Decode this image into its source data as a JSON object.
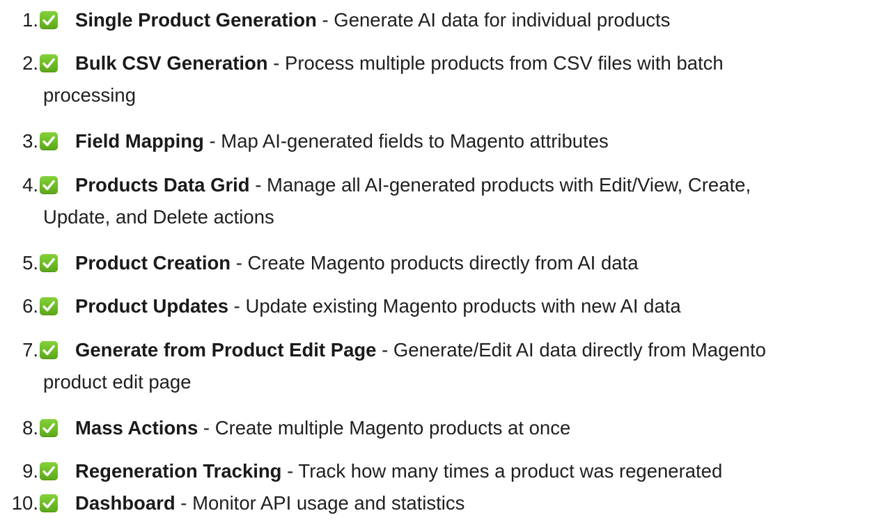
{
  "features": [
    {
      "num": "1.",
      "title": "Single Product Generation",
      "desc": " - Generate AI data for individual products",
      "cont": ""
    },
    {
      "num": "2.",
      "title": "Bulk CSV Generation",
      "desc": " - Process multiple products from CSV files with batch",
      "cont": "processing"
    },
    {
      "num": "3.",
      "title": "Field Mapping",
      "desc": " - Map AI-generated fields to Magento attributes",
      "cont": ""
    },
    {
      "num": "4.",
      "title": "Products Data Grid",
      "desc": " - Manage all AI-generated products with Edit/View, Create,",
      "cont": "Update, and Delete actions"
    },
    {
      "num": "5.",
      "title": "Product Creation",
      "desc": " - Create Magento products directly from AI data",
      "cont": ""
    },
    {
      "num": "6.",
      "title": "Product Updates",
      "desc": " - Update existing Magento products with new AI data",
      "cont": ""
    },
    {
      "num": "7.",
      "title": "Generate from Product Edit Page",
      "desc": " - Generate/Edit AI data directly from Magento",
      "cont": "product edit page"
    },
    {
      "num": "8.",
      "title": "Mass Actions",
      "desc": " - Create multiple Magento products at once",
      "cont": ""
    },
    {
      "num": "9.",
      "title": "Regeneration Tracking",
      "desc": " - Track how many times a product was regenerated",
      "cont": ""
    },
    {
      "num": "10.",
      "title": "Dashboard",
      "desc": " - Monitor API usage and statistics",
      "cont": ""
    }
  ],
  "icon": "check-mark-button-icon",
  "colors": {
    "check_bg": "#6fbf2a",
    "text": "#1f1f1f"
  }
}
